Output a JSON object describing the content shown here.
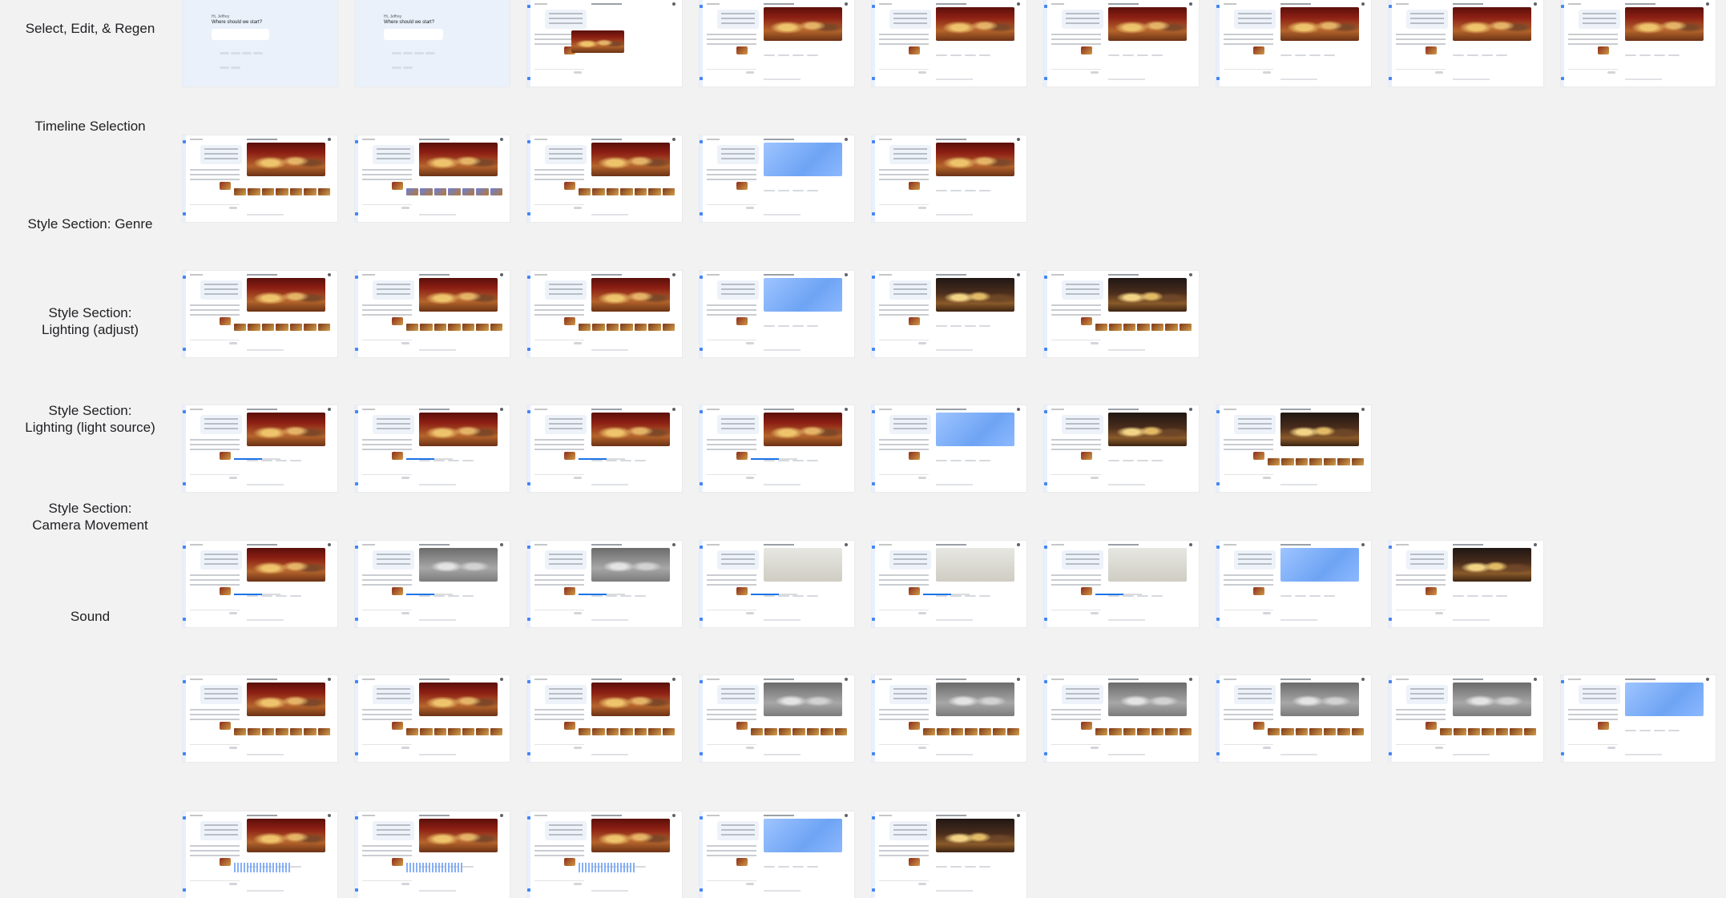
{
  "rows": [
    {
      "label": "Select, Edit, & Regen"
    },
    {
      "label": "Timeline Selection"
    },
    {
      "label": "Style Section: Genre"
    },
    {
      "label": "Style Section:\nLighting (adjust)"
    },
    {
      "label": "Style Section:\nLighting (light source)"
    },
    {
      "label": "Style Section:\nCamera Movement"
    },
    {
      "label": "Sound"
    }
  ],
  "home_screen": {
    "greeting": "Hi, Jeffrey",
    "prompt": "Where should we start?"
  },
  "colors": {
    "page_background": "#f2f2f2",
    "accent": "#4285f4",
    "home_background": "#eaf1fb",
    "placeholder_blue": "#6ea4f4"
  }
}
